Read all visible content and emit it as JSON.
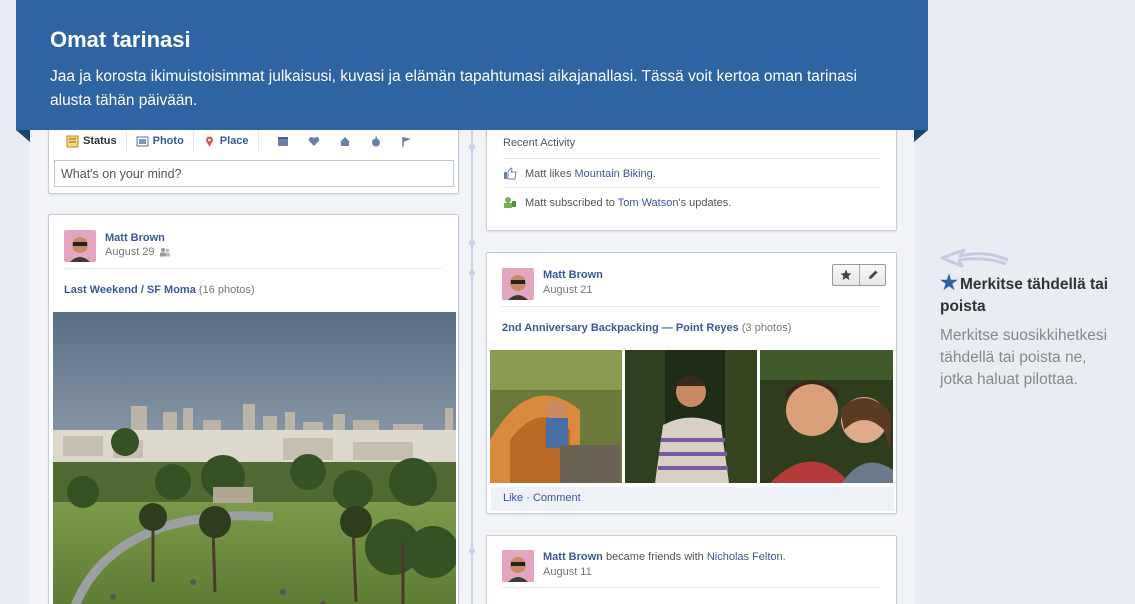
{
  "banner": {
    "title": "Omat tarinasi",
    "text": "Jaa ja korosta ikimuistoisimmat julkaisusi, kuvasi ja elämän tapahtumasi aikajanallasi. Tässä voit kertoa oman tarinasi alusta tähän päivään."
  },
  "composer": {
    "tabs": [
      "Status",
      "Photo",
      "Place"
    ],
    "placeholder": "What's on your mind?",
    "mini_icons": [
      "event-icon",
      "heart-icon",
      "home-icon",
      "health-icon",
      "flag-icon"
    ]
  },
  "recent_activity": {
    "title": "Recent Activity",
    "row1": {
      "prefix": "Matt likes ",
      "link": "Mountain Biking",
      "suffix": "."
    },
    "row2": {
      "prefix": "Matt subscribed to ",
      "link": "Tom Watson",
      "suffix": "'s updates."
    }
  },
  "post1": {
    "author": "Matt Brown",
    "date": "August 29",
    "album": "Last Weekend / SF Moma",
    "count": "(16 photos)"
  },
  "post2": {
    "author": "Matt Brown",
    "date": "August 21",
    "album": "2nd Anniversary Backpacking — Point Reyes",
    "count": "(3 photos)",
    "like": "Like",
    "sep": " · ",
    "comment": "Comment"
  },
  "post3": {
    "author": "Matt Brown",
    "middle": " became friends with ",
    "friend": "Nicholas Felton",
    "period": ".",
    "date": "August 11"
  },
  "tip": {
    "title": "Merkitse tähdellä tai poista",
    "text": "Merkitse suosikkihetkesi tähdellä tai poista ne, jotka haluat pilottaa."
  },
  "colors": {
    "banner": "#2e64a1",
    "link": "#3b5998",
    "background": "#e9ecf2"
  }
}
